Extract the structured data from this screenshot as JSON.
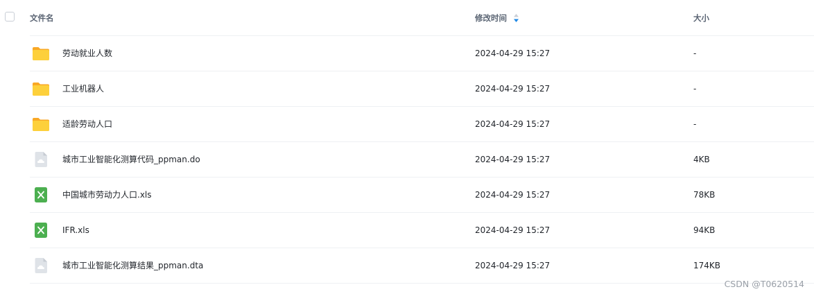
{
  "header": {
    "name_label": "文件名",
    "time_label": "修改时间",
    "size_label": "大小"
  },
  "files": [
    {
      "name": "劳动就业人数",
      "time": "2024-04-29 15:27",
      "size": "-",
      "icon": "folder-icon"
    },
    {
      "name": "工业机器人",
      "time": "2024-04-29 15:27",
      "size": "-",
      "icon": "folder-icon"
    },
    {
      "name": "适龄劳动人口",
      "time": "2024-04-29 15:27",
      "size": "-",
      "icon": "folder-icon"
    },
    {
      "name": "城市工业智能化测算代码_ppman.do",
      "time": "2024-04-29 15:27",
      "size": "4KB",
      "icon": "generic-file-icon"
    },
    {
      "name": "中国城市劳动力人口.xls",
      "time": "2024-04-29 15:27",
      "size": "78KB",
      "icon": "excel-file-icon"
    },
    {
      "name": "IFR.xls",
      "time": "2024-04-29 15:27",
      "size": "94KB",
      "icon": "excel-file-icon"
    },
    {
      "name": "城市工业智能化测算结果_ppman.dta",
      "time": "2024-04-29 15:27",
      "size": "174KB",
      "icon": "generic-file-icon"
    }
  ],
  "watermark": "CSDN @T0620514",
  "colors": {
    "folder": "#fbc02d",
    "excel": "#4caf50",
    "generic_file": "#dfe3e8",
    "sort_accent": "#1e88e5"
  }
}
